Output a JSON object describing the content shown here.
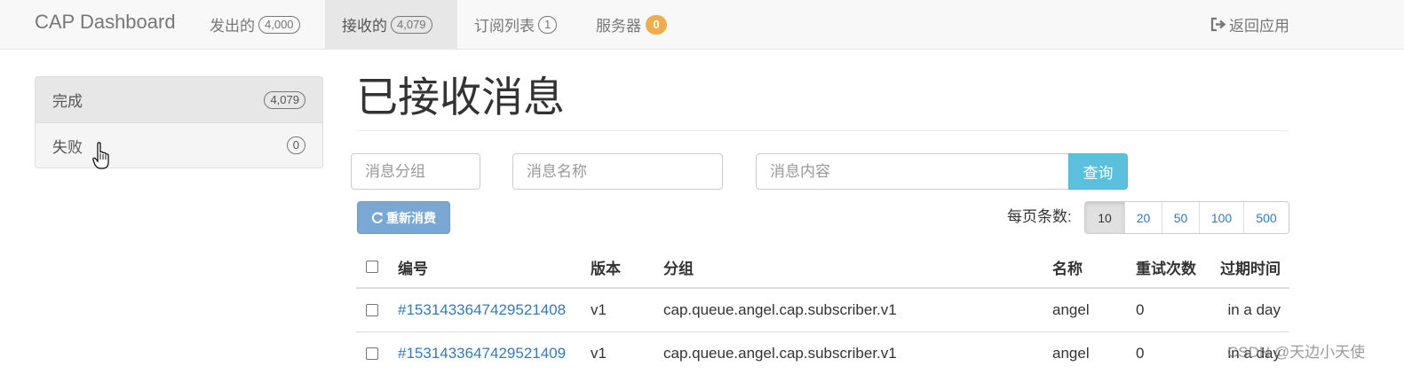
{
  "navbar": {
    "brand": "CAP Dashboard",
    "items": [
      {
        "label": "发出的",
        "count": "4,000"
      },
      {
        "label": "接收的",
        "count": "4,079"
      },
      {
        "label": "订阅列表",
        "count": "1"
      },
      {
        "label": "服务器",
        "count": "0"
      }
    ],
    "back_label": "返回应用"
  },
  "sidebar": {
    "items": [
      {
        "label": "完成",
        "count": "4,079"
      },
      {
        "label": "失败",
        "count": "0"
      }
    ]
  },
  "main": {
    "title": "已接收消息",
    "filters": {
      "group_placeholder": "消息分组",
      "name_placeholder": "消息名称",
      "content_placeholder": "消息内容",
      "query_label": "查询"
    },
    "requeue_label": "重新消费",
    "per_page_label": "每页条数:",
    "per_page_options": [
      "10",
      "20",
      "50",
      "100",
      "500"
    ],
    "per_page_selected": "10",
    "table": {
      "headers": [
        "编号",
        "版本",
        "分组",
        "名称",
        "重试次数",
        "过期时间"
      ],
      "rows": [
        {
          "id": "#1531433647429521408",
          "version": "v1",
          "group": "cap.queue.angel.cap.subscriber.v1",
          "name": "angel",
          "retries": "0",
          "expires": "in a day"
        },
        {
          "id": "#1531433647429521409",
          "version": "v1",
          "group": "cap.queue.angel.cap.subscriber.v1",
          "name": "angel",
          "retries": "0",
          "expires": "in a day"
        }
      ]
    }
  },
  "watermark": "CSDN @天边小天使",
  "colors": {
    "accent": "#337ab7",
    "info": "#5bc0de",
    "warning": "#f0ad4e",
    "primary_disabled": "#79a8d4"
  },
  "icons": {
    "back": "sign-out-icon",
    "requeue": "refresh-icon",
    "cursor": "hand-pointer-icon"
  }
}
